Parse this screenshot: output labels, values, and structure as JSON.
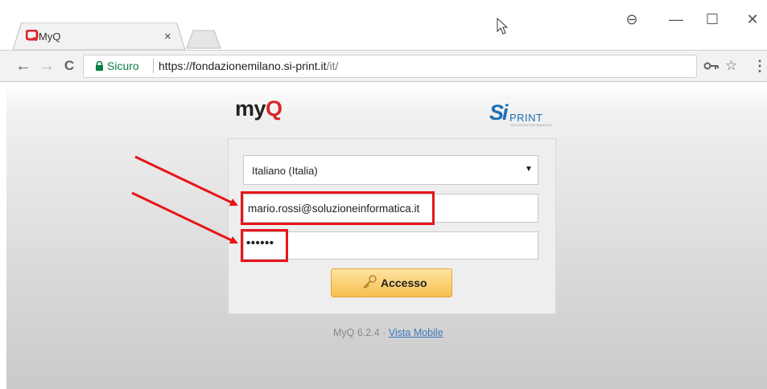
{
  "browser": {
    "tab": {
      "title": "MyQ"
    },
    "tab_close_glyph": "×",
    "window_controls": {
      "account": "⊖",
      "minimize": "—",
      "maximize": "☐",
      "close": "✕"
    },
    "nav": {
      "back": "←",
      "forward": "→",
      "reload": "C"
    },
    "address_bar": {
      "security_label": "Sicuro",
      "url_origin": "https://fondazionemilano.si-print.it",
      "url_path": "/it/"
    },
    "icons": [
      "key-icon",
      "star-icon",
      "menu-icon"
    ],
    "star_glyph": "☆",
    "menu_glyph": "⋮"
  },
  "page": {
    "logo_brand": {
      "text_my": "my",
      "text_q": "Q",
      "accent": "#d9262b"
    },
    "partner_logo": {
      "si": "Si",
      "print": "PRINT",
      "tagline": "SOLUZIONE INFORMATICA",
      "color": "#1d6fb4"
    },
    "login": {
      "language": {
        "selected": "Italiano (Italia)",
        "arrow": "▼"
      },
      "email_value": "mario.rossi@soluzioneinformatica.it",
      "password_masked": "••••••",
      "submit_label": "Accesso"
    },
    "footer": {
      "version": "MyQ 6.2.4 · ",
      "link": "Vista Mobile"
    }
  },
  "annotation": {
    "color": "#e8151b"
  }
}
